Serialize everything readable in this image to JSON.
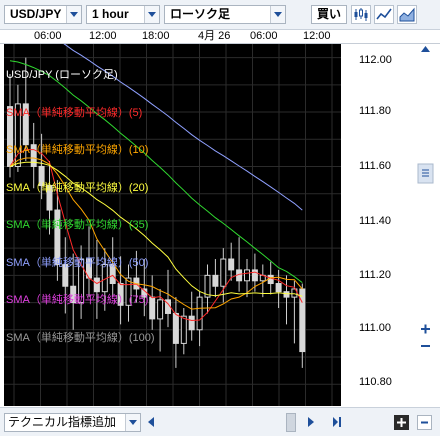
{
  "toolbar": {
    "pair": "USD/JPY",
    "interval": "1 hour",
    "chart_type": "ローソク足",
    "buy_label": "買い",
    "icons": [
      "candlestick-chart-icon",
      "line-chart-icon",
      "area-chart-icon"
    ]
  },
  "time_axis": {
    "labels": [
      "06:00",
      "12:00",
      "18:00",
      "4月 26",
      "06:00",
      "12:00"
    ]
  },
  "price_axis": {
    "labels": [
      "112.00",
      "111.80",
      "111.60",
      "111.40",
      "111.20",
      "111.00",
      "110.80"
    ]
  },
  "legend": {
    "title": "USD/JPY (ローソク足)",
    "items": [
      {
        "label": "SMA（単純移動平均線）(5)",
        "color": "#ff2a2a"
      },
      {
        "label": "SMA（単純移動平均線）(10)",
        "color": "#ffa600"
      },
      {
        "label": "SMA（単純移動平均線）(20)",
        "color": "#ffff40"
      },
      {
        "label": "SMA（単純移動平均線）(35)",
        "color": "#30d830"
      },
      {
        "label": "SMA（単純移動平均線）(50)",
        "color": "#8fa0ff"
      },
      {
        "label": "SMA（単純移動平均線）(75)",
        "color": "#e040e0"
      },
      {
        "label": "SMA（単純移動平均線）(100)",
        "color": "#9a9a9a"
      }
    ]
  },
  "bottom": {
    "technical_add_label": "テクニカル指標追加"
  },
  "colors": {
    "chart_bg": "#000000",
    "grid": "#2b2b2b",
    "candle": "#d8d8d8",
    "ui_bg": "#eef2f7",
    "accent": "#1e4f9a"
  },
  "candles": [
    {
      "o": 111.82,
      "h": 111.94,
      "l": 111.56,
      "c": 111.6
    },
    {
      "o": 111.6,
      "h": 111.9,
      "l": 111.58,
      "c": 111.83
    },
    {
      "o": 111.83,
      "h": 112.0,
      "l": 111.62,
      "c": 111.68
    },
    {
      "o": 111.68,
      "h": 111.76,
      "l": 111.52,
      "c": 111.6
    },
    {
      "o": 111.6,
      "h": 111.72,
      "l": 111.48,
      "c": 111.53
    },
    {
      "o": 111.53,
      "h": 111.62,
      "l": 111.35,
      "c": 111.44
    },
    {
      "o": 111.44,
      "h": 111.55,
      "l": 111.18,
      "c": 111.24
    },
    {
      "o": 111.24,
      "h": 111.34,
      "l": 111.06,
      "c": 111.16
    },
    {
      "o": 111.16,
      "h": 111.28,
      "l": 111.0,
      "c": 111.1
    },
    {
      "o": 111.1,
      "h": 111.31,
      "l": 111.04,
      "c": 111.26
    },
    {
      "o": 111.26,
      "h": 111.38,
      "l": 111.12,
      "c": 111.19
    },
    {
      "o": 111.19,
      "h": 111.33,
      "l": 111.04,
      "c": 111.14
    },
    {
      "o": 111.14,
      "h": 111.3,
      "l": 111.07,
      "c": 111.24
    },
    {
      "o": 111.24,
      "h": 111.34,
      "l": 111.12,
      "c": 111.17
    },
    {
      "o": 111.17,
      "h": 111.27,
      "l": 111.02,
      "c": 111.09
    },
    {
      "o": 111.09,
      "h": 111.24,
      "l": 111.03,
      "c": 111.19
    },
    {
      "o": 111.19,
      "h": 111.29,
      "l": 111.1,
      "c": 111.15
    },
    {
      "o": 111.15,
      "h": 111.26,
      "l": 111.05,
      "c": 111.12
    },
    {
      "o": 111.12,
      "h": 111.2,
      "l": 111.0,
      "c": 111.04
    },
    {
      "o": 111.04,
      "h": 111.15,
      "l": 110.92,
      "c": 111.11
    },
    {
      "o": 111.11,
      "h": 111.22,
      "l": 111.01,
      "c": 111.06
    },
    {
      "o": 111.06,
      "h": 111.12,
      "l": 110.86,
      "c": 110.95
    },
    {
      "o": 110.95,
      "h": 111.08,
      "l": 110.91,
      "c": 111.05
    },
    {
      "o": 111.05,
      "h": 111.14,
      "l": 110.96,
      "c": 111.0
    },
    {
      "o": 111.0,
      "h": 111.14,
      "l": 110.94,
      "c": 111.12
    },
    {
      "o": 111.12,
      "h": 111.24,
      "l": 111.06,
      "c": 111.2
    },
    {
      "o": 111.2,
      "h": 111.26,
      "l": 111.12,
      "c": 111.16
    },
    {
      "o": 111.16,
      "h": 111.3,
      "l": 111.1,
      "c": 111.26
    },
    {
      "o": 111.26,
      "h": 111.32,
      "l": 111.18,
      "c": 111.22
    },
    {
      "o": 111.22,
      "h": 111.34,
      "l": 111.14,
      "c": 111.18
    },
    {
      "o": 111.18,
      "h": 111.26,
      "l": 111.12,
      "c": 111.22
    },
    {
      "o": 111.22,
      "h": 111.28,
      "l": 111.14,
      "c": 111.18
    },
    {
      "o": 111.18,
      "h": 111.24,
      "l": 111.12,
      "c": 111.2
    },
    {
      "o": 111.2,
      "h": 111.25,
      "l": 111.13,
      "c": 111.17
    },
    {
      "o": 111.17,
      "h": 111.22,
      "l": 111.08,
      "c": 111.14
    },
    {
      "o": 111.14,
      "h": 111.2,
      "l": 111.02,
      "c": 111.12
    },
    {
      "o": 111.12,
      "h": 111.18,
      "l": 110.95,
      "c": 111.15
    },
    {
      "o": 111.15,
      "h": 111.17,
      "l": 110.86,
      "c": 110.92
    }
  ]
}
